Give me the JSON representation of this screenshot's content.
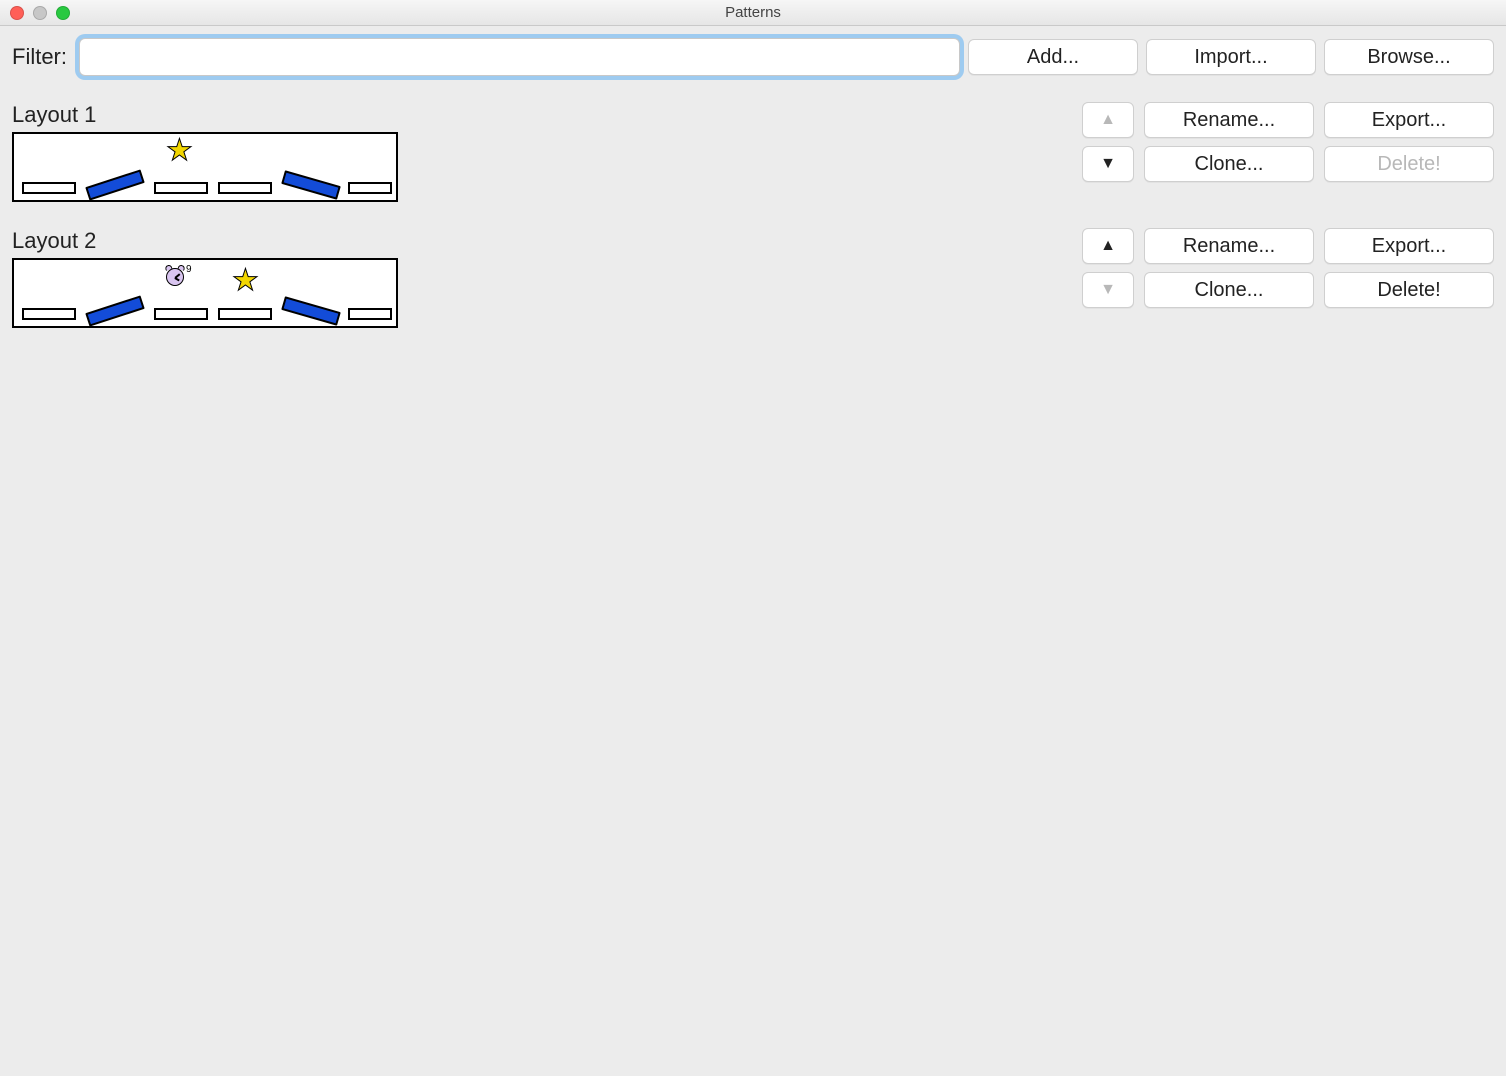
{
  "window": {
    "title": "Patterns"
  },
  "toolbar": {
    "filter_label": "Filter:",
    "filter_value": "",
    "add": "Add...",
    "import": "Import...",
    "browse": "Browse..."
  },
  "patterns": [
    {
      "name": "Layout 1",
      "has_clock": false,
      "up_enabled": false,
      "down_enabled": true,
      "delete_enabled": false
    },
    {
      "name": "Layout 2",
      "has_clock": true,
      "up_enabled": true,
      "down_enabled": false,
      "delete_enabled": true
    }
  ],
  "buttons": {
    "rename": "Rename...",
    "export": "Export...",
    "clone": "Clone...",
    "delete": "Delete!",
    "up_glyph": "▲",
    "down_glyph": "▼"
  }
}
